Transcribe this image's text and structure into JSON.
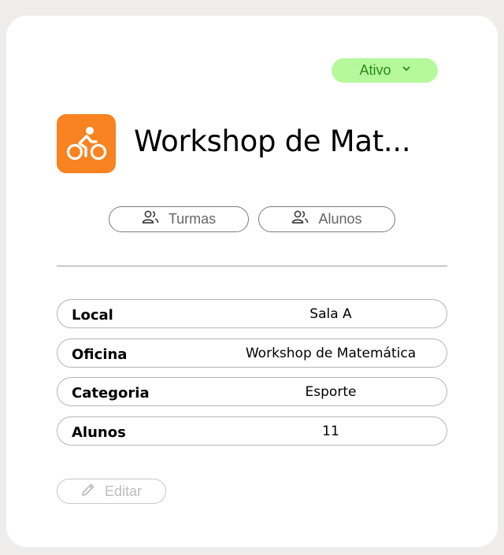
{
  "status": {
    "label": "Ativo",
    "dropdown_icon": "chevron-down-icon"
  },
  "workshop": {
    "title": "Workshop de Mat...",
    "icon": "bicycle-icon",
    "icon_color": "#f98221"
  },
  "tabs": [
    {
      "label": "Turmas",
      "icon": "users-icon"
    },
    {
      "label": "Alunos",
      "icon": "users-icon"
    }
  ],
  "details": [
    {
      "label": "Local",
      "value": "Sala A"
    },
    {
      "label": "Oficina",
      "value": "Workshop de Matemática"
    },
    {
      "label": "Categoria",
      "value": "Esporte"
    },
    {
      "label": "Alunos",
      "value": "11"
    }
  ],
  "actions": {
    "edit_label": "Editar",
    "edit_icon": "pencil-icon"
  },
  "colors": {
    "status_bg": "#b6f99c",
    "status_text": "#2a8b18",
    "accent": "#f98221"
  }
}
